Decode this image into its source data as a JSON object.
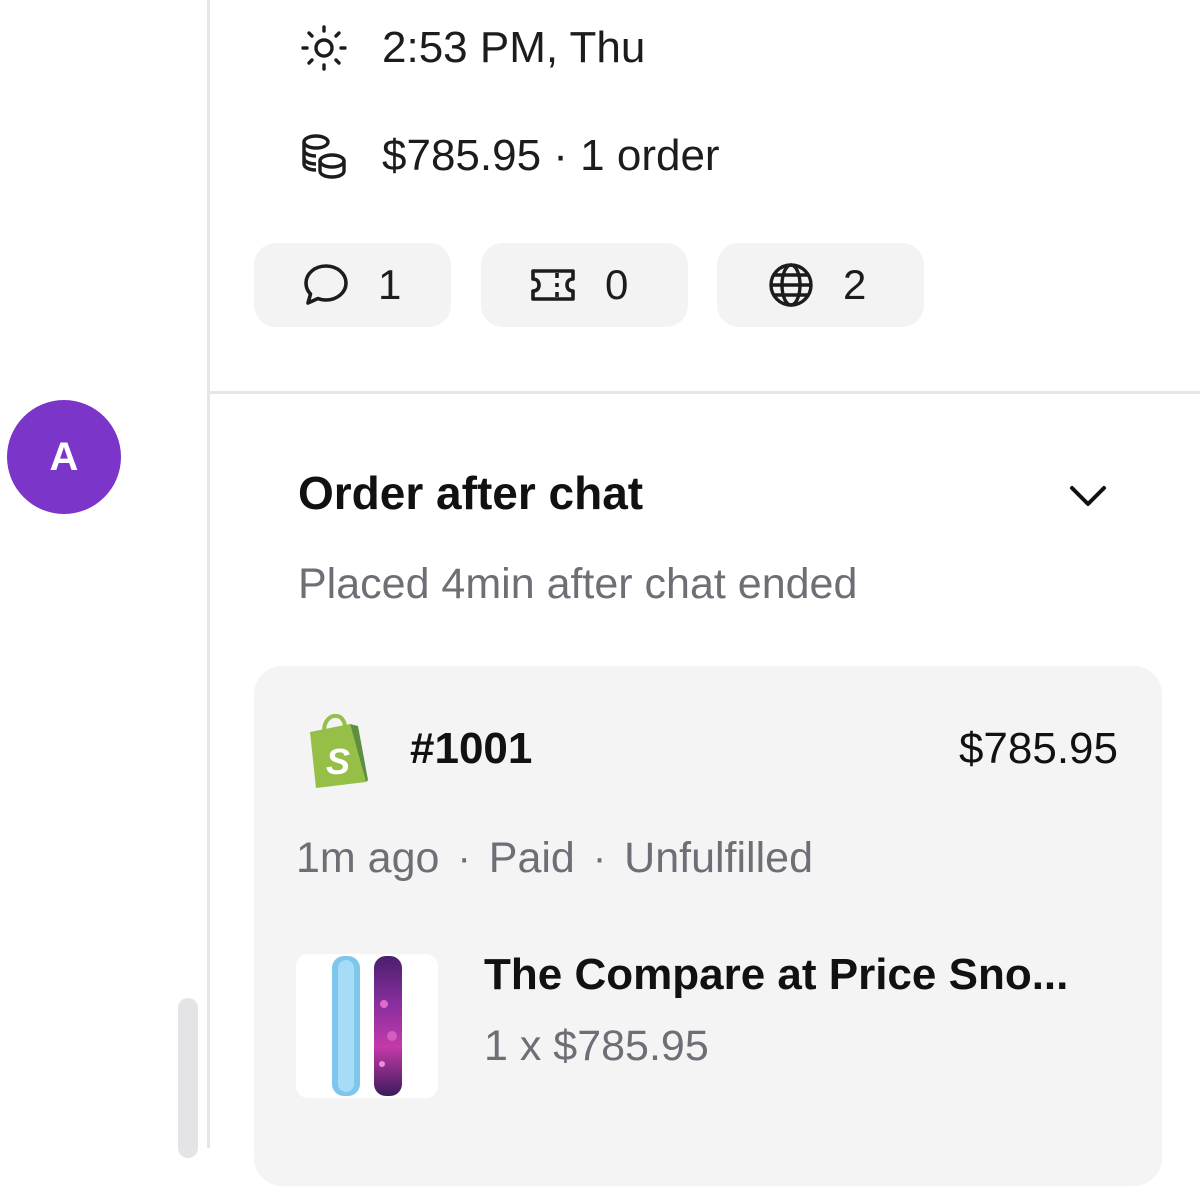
{
  "customer": {
    "avatar_initial": "A",
    "avatar_color": "#7b35c9",
    "local_time": "2:53 PM, Thu",
    "spend": "$785.95 · 1 order",
    "icons": {
      "time": "sun-icon",
      "spend": "coins-icon"
    }
  },
  "stats": [
    {
      "icon": "chat-bubble-icon",
      "value": "1"
    },
    {
      "icon": "ticket-icon",
      "value": "0"
    },
    {
      "icon": "globe-icon",
      "value": "2"
    }
  ],
  "order_section": {
    "title": "Order after chat",
    "subtitle": "Placed 4min after chat ended",
    "toggle_icon": "chevron-down-icon"
  },
  "order": {
    "source_icon": "shopify-icon",
    "number": "#1001",
    "total": "$785.95",
    "age": "1m ago",
    "payment_status": "Paid",
    "fulfillment_status": "Unfulfilled",
    "separator": "·",
    "item": {
      "name": "The Compare at Price Sno...",
      "quantity_price": "1 x $785.95",
      "thumbnail": "snowboard-product-image"
    }
  },
  "colors": {
    "accent": "#7b35c9",
    "shopify_green": "#95bf47",
    "muted_text": "#6e6e76",
    "card_bg": "#f4f4f5"
  }
}
